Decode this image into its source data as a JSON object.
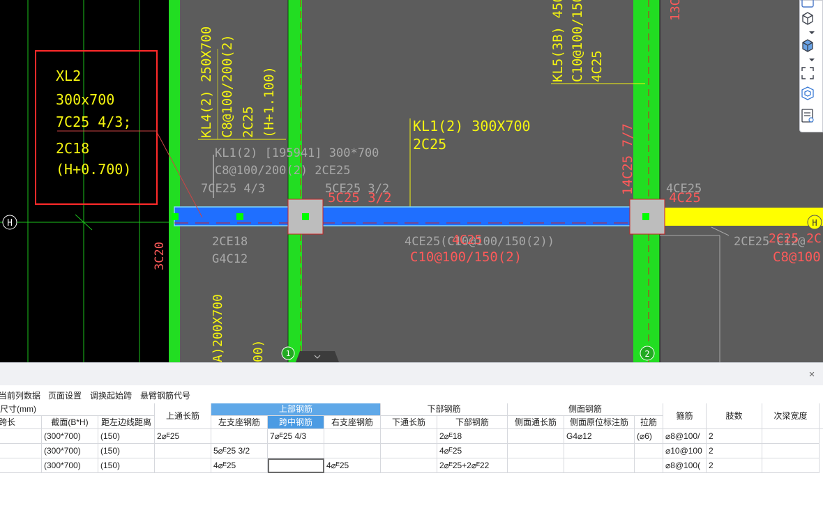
{
  "cad": {
    "tag_xl2": [
      "XL2",
      "300x700",
      "7C25 4/3;",
      "2C18",
      "(H+0.700)"
    ],
    "axis_h": "H",
    "axis_h_right": "H",
    "axis_1": "1",
    "axis_2": "2",
    "label_3c20": "3C20",
    "label_200x700": "200X700",
    "label_partial_paren": "00)",
    "label_partial_a": "A)",
    "label_kl4": [
      "KL4(2) 250X700",
      "C8@100/200(2)",
      "2C25",
      "(H+1.100)"
    ],
    "label_small_vert": "       ",
    "label_kl1_gray": [
      "KL1(2) [195941] 300*700",
      "C8@100/200(2) 2CE25"
    ],
    "label_7ce25": "7CE25 4/3",
    "label_5ce25": "5CE25 3/2",
    "label_5c25_red": "5C25 3/2",
    "label_kl1_yellow": [
      "KL1(2) 300X700",
      "2C25"
    ],
    "label_2ce18": [
      "2CE18",
      "G4C12"
    ],
    "label_4ce25_mid": "4CE25(C10@100/150(2))",
    "label_4c25_red_mid": "4C25",
    "label_c10_red": "C10@100/150(2)",
    "label_kl5": [
      "KL5(3B) 450X",
      "C10@100/150(4",
      "4C25"
    ],
    "label_13c": "13C",
    "label_14c25": "14C25 7/7",
    "label_4ce25_right": "4CE25",
    "label_4c25_red_right": "4C25",
    "label_2ce25_right": "2CE25 C12@",
    "label_2c25_red_right": "2C25 2C",
    "label_c8_red_right": "C8@100(2"
  },
  "colors": {
    "cad_bg": "#000000",
    "slab": "#5c5c5c",
    "column_green": "#22dd22",
    "beam_blue": "#1f6fff",
    "beam_yellow": "#ffff00",
    "annot_yellow": "#f5f510",
    "annot_red": "#ff5a5a",
    "annot_gray": "#a8a8a8",
    "header_blue": "#5fa8e8"
  },
  "toolbar": {
    "icons": [
      "3d-view-icon",
      "cube-outline-icon",
      "cube-solid-icon",
      "fit-view-icon",
      "layer-cube-icon",
      "property-list-icon"
    ]
  },
  "panel": {
    "close_label": "×",
    "menu": [
      "当前列数据",
      "页面设置",
      "调换起始跨",
      "悬臂钢筋代号"
    ]
  },
  "table": {
    "group_headers": {
      "size": "尺寸(mm)",
      "top_through": "上通长筋",
      "top_rebar": "上部钢筋",
      "bottom_rebar": "下部钢筋",
      "side_rebar": "侧面钢筋",
      "stirrup": "箍筋",
      "legs": "肢数",
      "secondary_width": "次梁宽度"
    },
    "sub_headers": {
      "span_length": "跨长",
      "section": "截面(B*H)",
      "edge_distance": "距左边线距离",
      "left_support": "左支座钢筋",
      "mid_span": "跨中钢筋",
      "right_support": "右支座钢筋",
      "bottom_through": "下通长筋",
      "bottom_bars": "下部钢筋",
      "side_through": "侧面通长筋",
      "side_original": "侧面原位标注筋",
      "tie": "拉筋"
    },
    "rows": [
      {
        "span": "",
        "section": "(300*700)",
        "edge": "(150)",
        "top_through": "2⌀ᴱ25",
        "left_support": "",
        "mid_span": "7⌀ᴱ25 4/3",
        "right_support": "",
        "bottom_through": "",
        "bottom_bars": "2⌀ᴱ18",
        "side_through": "",
        "side_original": "G4⌀12",
        "tie": "(⌀6)",
        "stirrup": "⌀8@100/",
        "legs": "2",
        "secondary": ""
      },
      {
        "span": "",
        "section": "(300*700)",
        "edge": "(150)",
        "top_through": "",
        "left_support": "5⌀ᴱ25 3/2",
        "mid_span": "",
        "right_support": "",
        "bottom_through": "",
        "bottom_bars": "4⌀ᴱ25",
        "side_through": "",
        "side_original": "",
        "tie": "",
        "stirrup": "⌀10@100",
        "legs": "2",
        "secondary": ""
      },
      {
        "span": "",
        "section": "(300*700)",
        "edge": "(150)",
        "top_through": "",
        "left_support": "4⌀ᴱ25",
        "mid_span": "",
        "right_support": "4⌀ᴱ25",
        "bottom_through": "",
        "bottom_bars": "2⌀ᴱ25+2⌀ᴱ22",
        "side_through": "",
        "side_original": "",
        "tie": "",
        "stirrup": "⌀8@100(",
        "legs": "2",
        "secondary": ""
      }
    ]
  }
}
